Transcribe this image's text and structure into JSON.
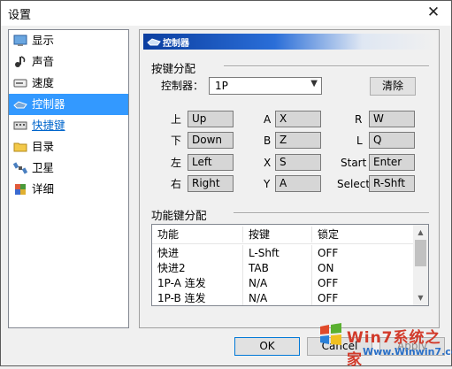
{
  "window": {
    "title": "设置",
    "close_glyph": "✕"
  },
  "sidebar": {
    "items": [
      {
        "label": "显示",
        "icon": "display-icon"
      },
      {
        "label": "声音",
        "icon": "sound-icon"
      },
      {
        "label": "速度",
        "icon": "speed-icon"
      },
      {
        "label": "控制器",
        "icon": "controller-icon",
        "selected": true
      },
      {
        "label": "快捷键",
        "icon": "shortcut-icon",
        "link": true
      },
      {
        "label": "目录",
        "icon": "folder-icon"
      },
      {
        "label": "卫星",
        "icon": "satellite-icon"
      },
      {
        "label": "详细",
        "icon": "details-icon"
      }
    ]
  },
  "panel": {
    "header": "控制器",
    "key_assign_title": "按键分配",
    "controller_label": "控制器：",
    "controller_value": "1P",
    "clear_button": "清除",
    "keys": [
      {
        "label": "上",
        "value": "Up"
      },
      {
        "label": "下",
        "value": "Down"
      },
      {
        "label": "左",
        "value": "Left"
      },
      {
        "label": "右",
        "value": "Right"
      },
      {
        "label": "A",
        "value": "X"
      },
      {
        "label": "B",
        "value": "Z"
      },
      {
        "label": "X",
        "value": "S"
      },
      {
        "label": "Y",
        "value": "A"
      },
      {
        "label": "R",
        "value": "W"
      },
      {
        "label": "L",
        "value": "Q"
      },
      {
        "label": "Start",
        "value": "Enter"
      },
      {
        "label": "Select",
        "value": "R-Shft"
      }
    ],
    "function_title": "功能键分配",
    "table": {
      "headers": [
        "功能",
        "按键",
        "锁定"
      ],
      "rows": [
        [
          "快进",
          "L-Shft",
          "OFF"
        ],
        [
          "快进2",
          "TAB",
          "ON"
        ],
        [
          "1P-A 连发",
          "N/A",
          "OFF"
        ],
        [
          "1P-B 连发",
          "N/A",
          "OFF"
        ]
      ]
    }
  },
  "footer": {
    "ok": "OK",
    "cancel": "Cancel",
    "apply": "Apply"
  },
  "watermark": {
    "text": "Win7系统之家",
    "url": "Www.Winwin7.com"
  },
  "colors": {
    "selection": "#3399ff",
    "link": "#0066cc",
    "header_dark": "#0b3ea0"
  }
}
